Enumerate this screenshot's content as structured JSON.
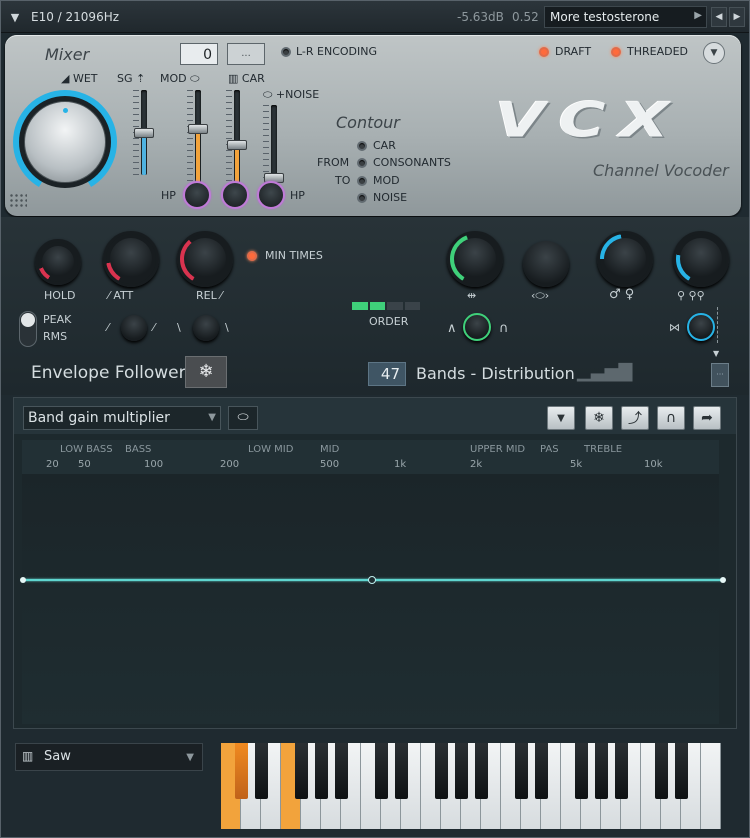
{
  "topbar": {
    "preset_slot": "E10 / 21096Hz",
    "level": "-5.63dB",
    "value": "0.52",
    "preset_name": "More testosterone"
  },
  "mixer": {
    "title": "Mixer",
    "wet": "WET",
    "sg": "SG",
    "mod": "MOD",
    "car": "CAR",
    "noise": "+NOISE",
    "hp_left": "HP",
    "hp_right": "HP",
    "number_box": "0",
    "dots": "···"
  },
  "lr_encoding": "L-R ENCODING",
  "draft": "DRAFT",
  "threaded": "THREADED",
  "contour": {
    "title": "Contour",
    "from": "FROM",
    "to": "TO",
    "options": [
      "CAR",
      "CONSONANTS",
      "MOD",
      "NOISE"
    ]
  },
  "logo": {
    "text": "VCX",
    "subtitle": "Channel Vocoder"
  },
  "envelope": {
    "hold": "HOLD",
    "att": "ATT",
    "rel": "REL",
    "min_times": "MIN TIMES",
    "peak": "PEAK",
    "rms": "RMS",
    "order": "ORDER",
    "title": "Envelope Follower"
  },
  "bands": {
    "count": "47",
    "label": "Bands - Distribution"
  },
  "graph": {
    "dropdown": "Band gain multiplier",
    "freq_regions": [
      "LOW BASS",
      "BASS",
      "LOW MID",
      "MID",
      "UPPER MID",
      "PAS",
      "TREBLE"
    ],
    "freq_ticks": [
      "20",
      "50",
      "100",
      "200",
      "500",
      "1k",
      "2k",
      "5k",
      "10k"
    ]
  },
  "waveform": {
    "selected": "Saw"
  },
  "colors": {
    "accent_teal": "#2bd0c8",
    "accent_blue": "#27b3e6",
    "accent_red": "#d9334f",
    "accent_green": "#3fd07a",
    "led_on": "#ff6a3b",
    "key_highlight": "#f2a33c"
  }
}
